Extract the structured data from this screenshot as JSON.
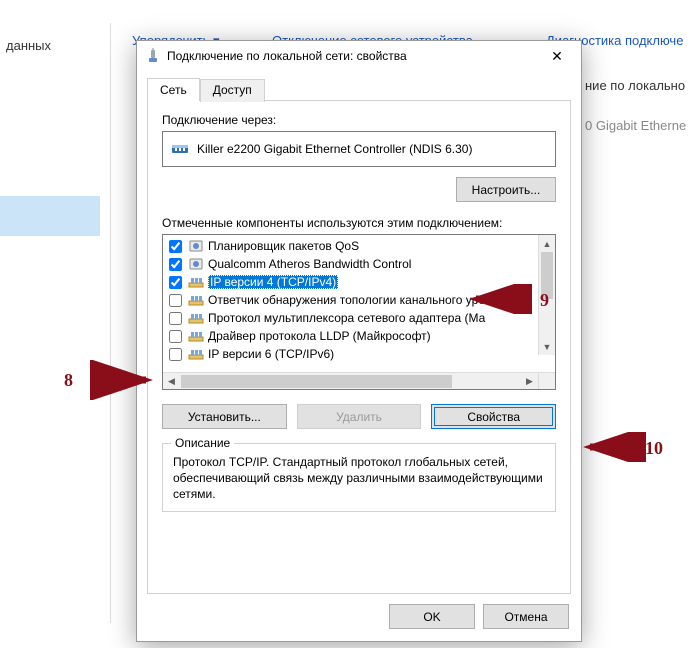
{
  "bg": {
    "data_label": "данных",
    "toolbar_manage": "Упорядочить ▾",
    "toolbar_disable": "Отключение сетевого устройства",
    "toolbar_diag": "Диагностика подключе",
    "row_conn": "ние по локально",
    "row_nic": "0 Gigabit Etherne"
  },
  "dialog": {
    "title": "Подключение по локальной сети: свойства",
    "tabs": {
      "network": "Сеть",
      "sharing": "Доступ"
    },
    "connect_via": "Подключение через:",
    "adapter_name": "Killer e2200 Gigabit Ethernet Controller (NDIS 6.30)",
    "configure_btn": "Настроить...",
    "components_label": "Отмеченные компоненты используются этим подключением:",
    "components": [
      {
        "checked": true,
        "label": "Планировщик пакетов QoS"
      },
      {
        "checked": true,
        "label": "Qualcomm Atheros Bandwidth Control"
      },
      {
        "checked": true,
        "label": "IP версии 4 (TCP/IPv4)",
        "selected": true
      },
      {
        "checked": false,
        "label": "Ответчик обнаружения топологии канального уров"
      },
      {
        "checked": false,
        "label": "Протокол мультиплексора сетевого адаптера (Ма"
      },
      {
        "checked": false,
        "label": "Драйвер протокола LLDP (Майкрософт)"
      },
      {
        "checked": false,
        "label": "IP версии 6 (TCP/IPv6)"
      }
    ],
    "install_btn": "Установить...",
    "remove_btn": "Удалить",
    "props_btn": "Свойства",
    "desc_legend": "Описание",
    "desc_text": "Протокол TCP/IP. Стандартный протокол глобальных сетей, обеспечивающий связь между различными взаимодействующими сетями.",
    "ok_btn": "OK",
    "cancel_btn": "Отмена"
  },
  "annotations": {
    "a8": "8",
    "a9": "9",
    "a10": "10"
  }
}
